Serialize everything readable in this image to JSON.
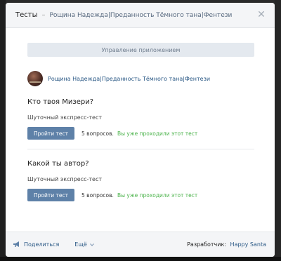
{
  "header": {
    "title": "Тесты",
    "separator": "–",
    "subtitle": "Рощина Надежда|Преданность Тёмного тана|Фентези"
  },
  "manage_button": "Управление приложением",
  "author": {
    "name": "Рощина Надежда|Преданность Тёмного тана|Фентези"
  },
  "tests": [
    {
      "title": "Кто твоя Мизери?",
      "subtitle": "Шуточный экспресс-тест",
      "button": "Пройти тест",
      "question_count": "5 вопросов.",
      "status": "Вы уже проходили этот тест"
    },
    {
      "title": "Какой ты автор?",
      "subtitle": "Шуточный экспресс-тест",
      "button": "Пройти тест",
      "question_count": "5 вопросов.",
      "status": "Вы уже проходили этот тест"
    }
  ],
  "footer": {
    "share": "Поделиться",
    "more": "Ещё",
    "developer_label": "Разработчик:",
    "developer_name": "Happy Santa"
  },
  "icons": {
    "close": "close-icon",
    "share": "megaphone-icon",
    "more": "chevron-down-icon"
  },
  "colors": {
    "accent": "#5e81a8",
    "link": "#2a5885",
    "passed": "#4bb34b"
  }
}
